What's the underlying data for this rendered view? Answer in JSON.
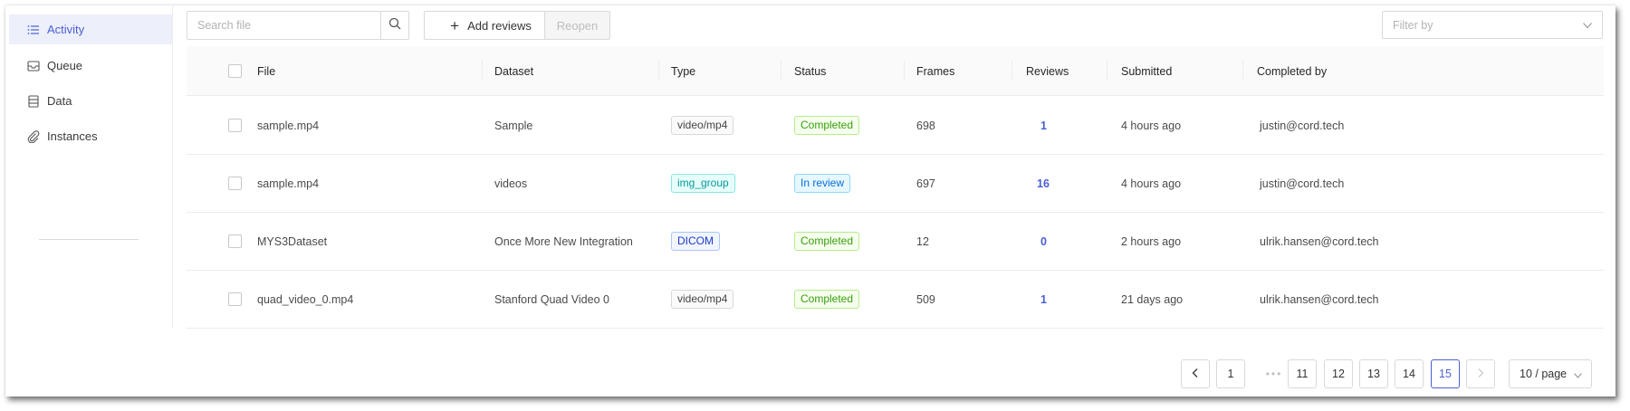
{
  "sidebar": {
    "items": [
      {
        "label": "Activity",
        "icon": "list-icon",
        "active": true
      },
      {
        "label": "Queue",
        "icon": "inbox-icon",
        "active": false
      },
      {
        "label": "Data",
        "icon": "database-icon",
        "active": false
      },
      {
        "label": "Instances",
        "icon": "paperclip-icon",
        "active": false
      }
    ]
  },
  "toolbar": {
    "search_placeholder": "Search file",
    "search_value": "",
    "add_reviews_label": "Add reviews",
    "reopen_label": "Reopen",
    "filter_placeholder": "Filter by"
  },
  "table": {
    "columns": [
      "File",
      "Dataset",
      "Type",
      "Status",
      "Frames",
      "Reviews",
      "Submitted",
      "Completed by"
    ],
    "rows": [
      {
        "file": "sample.mp4",
        "dataset": "Sample",
        "type": "video/mp4",
        "type_style": "default",
        "status": "Completed",
        "status_style": "green",
        "frames": "698",
        "reviews": "1",
        "submitted": "4 hours ago",
        "completed_by": "justin@cord.tech"
      },
      {
        "file": "sample.mp4",
        "dataset": "videos",
        "type": "img_group",
        "type_style": "cyan",
        "status": "In review",
        "status_style": "blue",
        "frames": "697",
        "reviews": "16",
        "submitted": "4 hours ago",
        "completed_by": "justin@cord.tech"
      },
      {
        "file": "MYS3Dataset",
        "dataset": "Once More New Integration",
        "type": "DICOM",
        "type_style": "geek",
        "status": "Completed",
        "status_style": "green",
        "frames": "12",
        "reviews": "0",
        "submitted": "2 hours ago",
        "completed_by": "ulrik.hansen@cord.tech"
      },
      {
        "file": "quad_video_0.mp4",
        "dataset": "Stanford Quad Video 0",
        "type": "video/mp4",
        "type_style": "default",
        "status": "Completed",
        "status_style": "green",
        "frames": "509",
        "reviews": "1",
        "submitted": "21 days ago",
        "completed_by": "ulrik.hansen@cord.tech"
      }
    ]
  },
  "pagination": {
    "pages": [
      "1",
      "11",
      "12",
      "13",
      "14",
      "15"
    ],
    "current": "15",
    "ellipsis": "•••",
    "page_size": "10 / page"
  },
  "colors": {
    "accent": "#4a5fd4",
    "completed": "#389e0d",
    "in_review": "#096dd9"
  }
}
